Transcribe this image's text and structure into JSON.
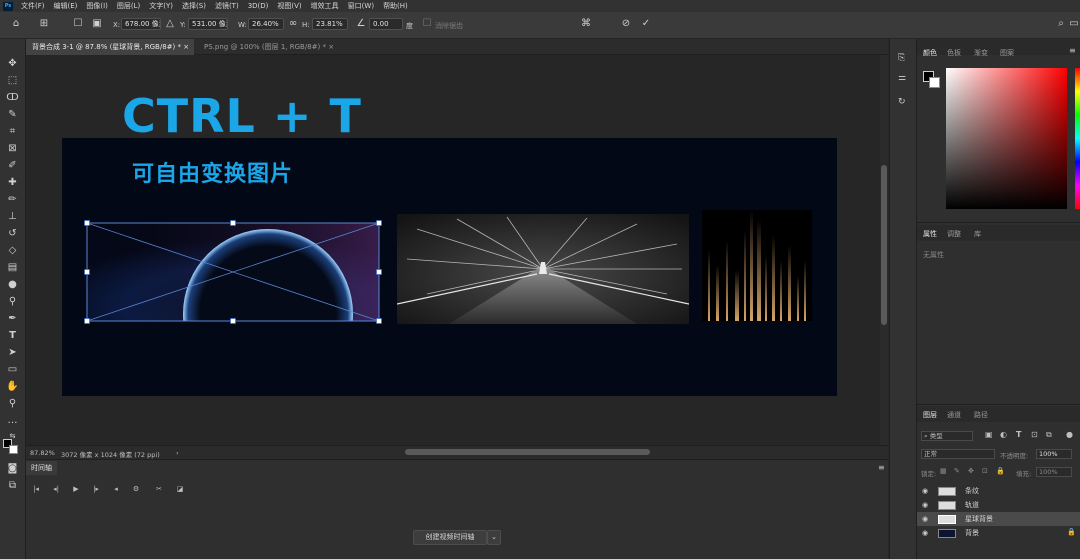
{
  "menu": {
    "logo": "Ps",
    "items": [
      "文件(F)",
      "编辑(E)",
      "图像(I)",
      "图层(L)",
      "文字(Y)",
      "选择(S)",
      "滤镜(T)",
      "3D(D)",
      "视图(V)",
      "增效工具",
      "窗口(W)",
      "帮助(H)"
    ]
  },
  "options": {
    "x_label": "X:",
    "x_value": "678.00 像素",
    "y_label": "Y:",
    "y_value": "531.00 像素",
    "w_label": "W:",
    "w_value": "26.40%",
    "h_label": "H:",
    "h_value": "23.81%",
    "angle_value": "0.00",
    "angle_unit": "度",
    "interp_label": "消除锯齿",
    "cancel_icon": "cancel-icon",
    "commit_icon": "checkmark-icon"
  },
  "tabs": [
    {
      "label": "背景合成 3-1 @ 87.8% (星球背景, RGB/8#) *",
      "close": "×"
    },
    {
      "label": "PS.png @ 100% (图层 1, RGB/8#) *",
      "close": "×"
    }
  ],
  "canvas": {
    "title": "CTRL + T",
    "subtitle": "可自由变换图片"
  },
  "status": {
    "zoom": "87.82%",
    "doc_info": "3072 像素 x 1024 像素 (72 ppi)",
    "arrow": "‹"
  },
  "timeline": {
    "tab_label": "时间轴",
    "create_button": "创建视频时间轴",
    "dropdown": "⌄"
  },
  "color_panel": {
    "tabs": [
      "颜色",
      "色板",
      "渐变",
      "图案"
    ],
    "active_tab": "颜色"
  },
  "properties_panel": {
    "tabs": [
      "属性",
      "调整",
      "库"
    ],
    "no_properties": "无属性"
  },
  "layers_panel": {
    "tabs": [
      "图层",
      "通道",
      "路径"
    ],
    "filter_placeholder": "类型",
    "blend_mode": "正常",
    "opacity_label": "不透明度:",
    "opacity_value": "100%",
    "lock_label": "锁定:",
    "fill_label": "填充:",
    "fill_value": "100%",
    "layers": [
      {
        "name": "条纹",
        "selected": false
      },
      {
        "name": "轨道",
        "selected": false
      },
      {
        "name": "星球背景",
        "selected": true
      },
      {
        "name": "背景",
        "selected": false
      }
    ]
  }
}
